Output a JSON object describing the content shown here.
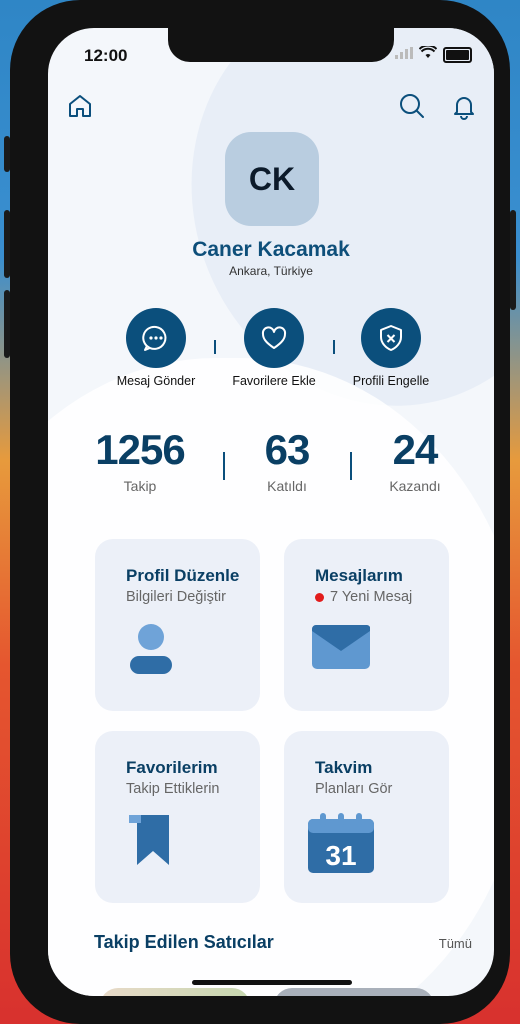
{
  "status": {
    "time": "12:00"
  },
  "header": {
    "home_icon": "home-icon",
    "search_icon": "search-icon",
    "bell_icon": "bell-icon"
  },
  "profile": {
    "initials": "CK",
    "name": "Caner Kacamak",
    "location": "Ankara, Türkiye"
  },
  "actions": [
    {
      "label": "Mesaj Gönder",
      "icon": "chat-icon"
    },
    {
      "label": "Favorilere Ekle",
      "icon": "heart-icon"
    },
    {
      "label": "Profili Engelle",
      "icon": "shield-block-icon"
    }
  ],
  "stats": [
    {
      "value": "1256",
      "label": "Takip"
    },
    {
      "value": "63",
      "label": "Katıldı"
    },
    {
      "value": "24",
      "label": "Kazandı"
    }
  ],
  "cards": [
    {
      "title": "Profil Düzenle",
      "subtitle": "Bilgileri Değiştir",
      "icon": "user-icon"
    },
    {
      "title": "Mesajlarım",
      "subtitle": "7 Yeni Mesaj",
      "icon": "envelope-icon",
      "badge_color": "#e21c1c"
    },
    {
      "title": "Favorilerim",
      "subtitle": "Takip Ettiklerin",
      "icon": "bookmark-icon"
    },
    {
      "title": "Takvim",
      "subtitle": "Planları Gör",
      "icon": "calendar-icon",
      "calendar_day": "31"
    }
  ],
  "followed_sellers": {
    "title": "Takip Edilen Satıcılar",
    "see_all": "Tümü"
  },
  "colors": {
    "primary": "#0b4f7c",
    "accent_light": "#4a8cc7",
    "card_bg": "#ecf0f8"
  }
}
